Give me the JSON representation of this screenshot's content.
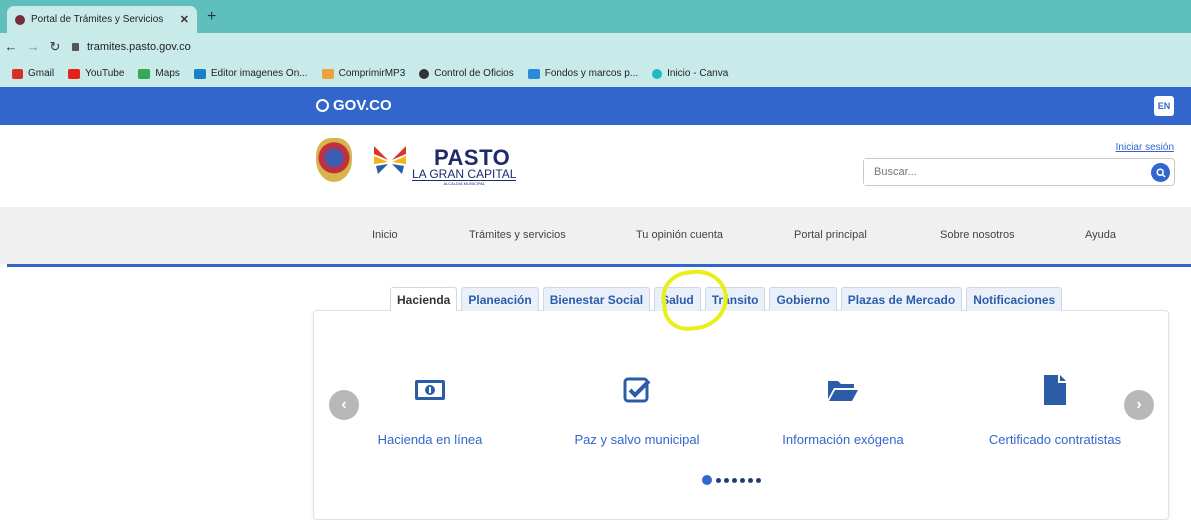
{
  "browser": {
    "tab_title": "Portal de Trámites y Servicios - A",
    "url": "tramites.pasto.gov.co",
    "bookmarks": [
      "Gmail",
      "YouTube",
      "Maps",
      "Editor imagenes On...",
      "ComprimirMP3",
      "Control de Oficios",
      "Fondos y marcos p...",
      "Inicio - Canva"
    ]
  },
  "govbar": {
    "logo": "GOV.CO",
    "lang": "EN"
  },
  "header": {
    "brand_title": "PASTO",
    "brand_subtitle": "LA GRAN CAPITAL",
    "brand_small": "ALCALDÍA MUNICIPAL",
    "login": "Iniciar sesión",
    "search_placeholder": "Buscar..."
  },
  "menu": [
    "Inicio",
    "Trámites y servicios",
    "Tu opinión cuenta",
    "Portal principal",
    "Sobre nosotros",
    "Ayuda"
  ],
  "tabs": [
    "Hacienda",
    "Planeación",
    "Bienestar Social",
    "Salud",
    "Tránsito",
    "Gobierno",
    "Plazas de Mercado",
    "Notificaciones"
  ],
  "active_tab": "Hacienda",
  "cards": [
    {
      "label": "Hacienda en línea",
      "icon": "money-bill-icon"
    },
    {
      "label": "Paz y salvo municipal",
      "icon": "check-square-icon"
    },
    {
      "label": "Información exógena",
      "icon": "folder-open-icon"
    },
    {
      "label": "Certificado contratistas",
      "icon": "file-icon"
    }
  ],
  "carousel": {
    "pages": 7,
    "current": 1
  },
  "colors": {
    "gov_blue": "#3366cc",
    "browser_teal": "#5ebfbd",
    "highlight": "#e9ef1a"
  }
}
